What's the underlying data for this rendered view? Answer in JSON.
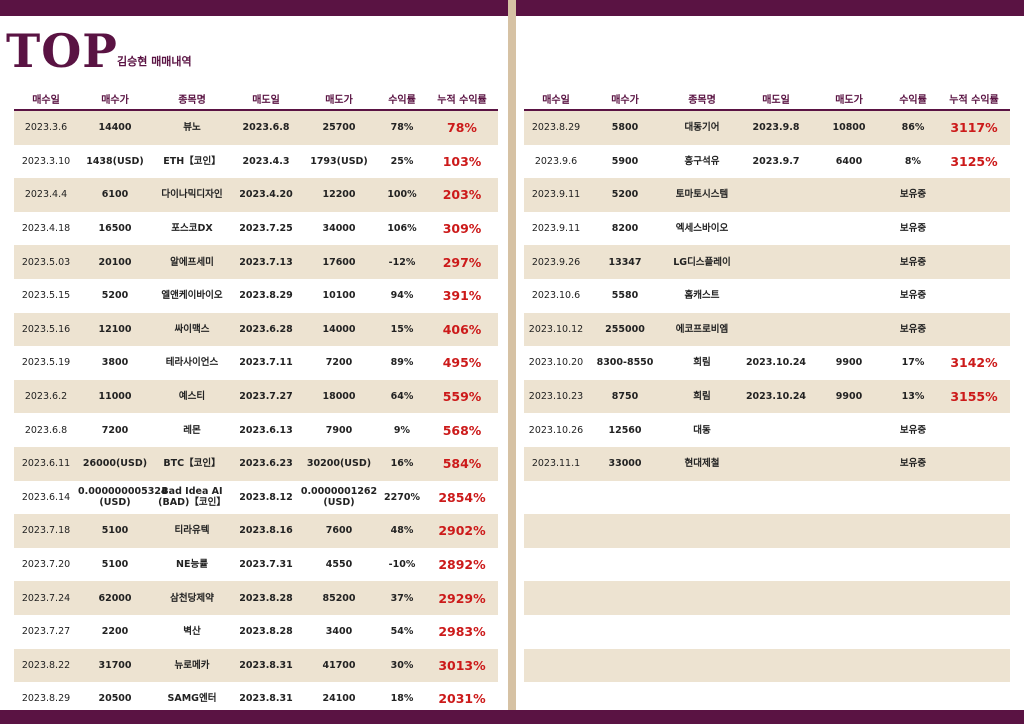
{
  "header": {
    "title": "TOP",
    "subtitle": "김승현 매매내역"
  },
  "columns": [
    "매수일",
    "매수가",
    "종목명",
    "매도일",
    "매도가",
    "수익률",
    "누적 수익률"
  ],
  "left_rows": [
    [
      "2023.3.6",
      "14400",
      "뷰노",
      "2023.6.8",
      "25700",
      "78%",
      "78%"
    ],
    [
      "2023.3.10",
      "1438(USD)",
      "ETH【코인】",
      "2023.4.3",
      "1793(USD)",
      "25%",
      "103%"
    ],
    [
      "2023.4.4",
      "6100",
      "다이나믹디자인",
      "2023.4.20",
      "12200",
      "100%",
      "203%"
    ],
    [
      "2023.4.18",
      "16500",
      "포스코DX",
      "2023.7.25",
      "34000",
      "106%",
      "309%"
    ],
    [
      "2023.5.03",
      "20100",
      "알에프세미",
      "2023.7.13",
      "17600",
      "-12%",
      "297%"
    ],
    [
      "2023.5.15",
      "5200",
      "엘앤케이바이오",
      "2023.8.29",
      "10100",
      "94%",
      "391%"
    ],
    [
      "2023.5.16",
      "12100",
      "싸이맥스",
      "2023.6.28",
      "14000",
      "15%",
      "406%"
    ],
    [
      "2023.5.19",
      "3800",
      "테라사이언스",
      "2023.7.11",
      "7200",
      "89%",
      "495%"
    ],
    [
      "2023.6.2",
      "11000",
      "예스티",
      "2023.7.27",
      "18000",
      "64%",
      "559%"
    ],
    [
      "2023.6.8",
      "7200",
      "레몬",
      "2023.6.13",
      "7900",
      "9%",
      "568%"
    ],
    [
      "2023.6.11",
      "26000(USD)",
      "BTC【코인】",
      "2023.6.23",
      "30200(USD)",
      "16%",
      "584%"
    ],
    [
      "2023.6.14",
      "0.000000005324\n(USD)",
      "Bad Idea AI\n(BAD)【코인】",
      "2023.8.12",
      "0.0000001262\n(USD)",
      "2270%",
      "2854%"
    ],
    [
      "2023.7.18",
      "5100",
      "티라유텍",
      "2023.8.16",
      "7600",
      "48%",
      "2902%"
    ],
    [
      "2023.7.20",
      "5100",
      "NE능률",
      "2023.7.31",
      "4550",
      "-10%",
      "2892%"
    ],
    [
      "2023.7.24",
      "62000",
      "삼천당제약",
      "2023.8.28",
      "85200",
      "37%",
      "2929%"
    ],
    [
      "2023.7.27",
      "2200",
      "벽산",
      "2023.8.28",
      "3400",
      "54%",
      "2983%"
    ],
    [
      "2023.8.22",
      "31700",
      "뉴로메카",
      "2023.8.31",
      "41700",
      "30%",
      "3013%"
    ],
    [
      "2023.8.29",
      "20500",
      "SAMG엔터",
      "2023.8.31",
      "24100",
      "18%",
      "2031%"
    ]
  ],
  "right_rows": [
    [
      "2023.8.29",
      "5800",
      "대동기어",
      "2023.9.8",
      "10800",
      "86%",
      "3117%"
    ],
    [
      "2023.9.6",
      "5900",
      "흥구석유",
      "2023.9.7",
      "6400",
      "8%",
      "3125%"
    ],
    [
      "2023.9.11",
      "5200",
      "토마토시스템",
      "",
      "",
      "보유중",
      ""
    ],
    [
      "2023.9.11",
      "8200",
      "엑세스바이오",
      "",
      "",
      "보유중",
      ""
    ],
    [
      "2023.9.26",
      "13347",
      "LG디스플레이",
      "",
      "",
      "보유중",
      ""
    ],
    [
      "2023.10.6",
      "5580",
      "홈캐스트",
      "",
      "",
      "보유중",
      ""
    ],
    [
      "2023.10.12",
      "255000",
      "에코프로비엠",
      "",
      "",
      "보유중",
      ""
    ],
    [
      "2023.10.20",
      "8300-8550",
      "희림",
      "2023.10.24",
      "9900",
      "17%",
      "3142%"
    ],
    [
      "2023.10.23",
      "8750",
      "희림",
      "2023.10.24",
      "9900",
      "13%",
      "3155%"
    ],
    [
      "2023.10.26",
      "12560",
      "대동",
      "",
      "",
      "보유중",
      ""
    ],
    [
      "2023.11.1",
      "33000",
      "현대제철",
      "",
      "",
      "보유중",
      ""
    ],
    [
      "",
      "",
      "",
      "",
      "",
      "",
      ""
    ],
    [
      "",
      "",
      "",
      "",
      "",
      "",
      ""
    ],
    [
      "",
      "",
      "",
      "",
      "",
      "",
      ""
    ],
    [
      "",
      "",
      "",
      "",
      "",
      "",
      ""
    ],
    [
      "",
      "",
      "",
      "",
      "",
      "",
      ""
    ],
    [
      "",
      "",
      "",
      "",
      "",
      "",
      ""
    ]
  ]
}
